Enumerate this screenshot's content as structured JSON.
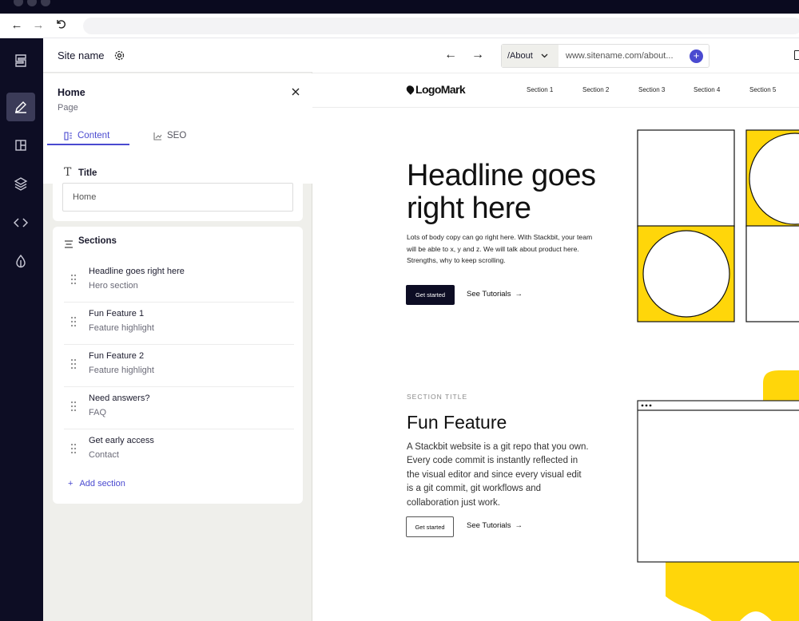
{
  "editor": {
    "site_name": "Site name",
    "page": {
      "title": "Home",
      "subtitle": "Page"
    },
    "tabs": [
      {
        "label": "Content",
        "icon": "content-icon",
        "active": true
      },
      {
        "label": "SEO",
        "icon": "chart-icon",
        "active": false
      }
    ],
    "title_field": {
      "label": "Title",
      "value": "Home"
    },
    "sections": {
      "label": "Sections",
      "items": [
        {
          "title": "Headline goes right here",
          "type": "Hero section"
        },
        {
          "title": "Fun Feature 1",
          "type": "Feature highlight"
        },
        {
          "title": "Fun Feature 2",
          "type": "Feature highlight"
        },
        {
          "title": "Need answers?",
          "type": "FAQ"
        },
        {
          "title": "Get early access",
          "type": "Contact"
        }
      ],
      "add_label": "Add section"
    }
  },
  "preview_toolbar": {
    "path": "/About",
    "url": "www.sitename.com/about..."
  },
  "site": {
    "logo": "LogoMark",
    "nav": [
      "Section 1",
      "Section 2",
      "Section 3",
      "Section 4",
      "Section 5"
    ],
    "hero": {
      "headline": "Headline goes right here",
      "body": "Lots of body copy can go right here. With Stackbit, your team will be able to x, y and z. We will talk about product here. Strengths, why to keep scrolling.",
      "cta": "Get started",
      "link": "See Tutorials"
    },
    "feature": {
      "eyebrow": "SECTION TITLE",
      "title": "Fun Feature",
      "body": "A Stackbit website is a git repo that you own. Every code commit is instantly reflected in the visual editor and since every visual edit is a git commit, git workflows and collaboration just work.",
      "cta": "Get started",
      "link": "See Tutorials"
    }
  },
  "colors": {
    "accent": "#4a4ad0",
    "rail": "#0d0d24",
    "yellow": "#ffd60a"
  }
}
